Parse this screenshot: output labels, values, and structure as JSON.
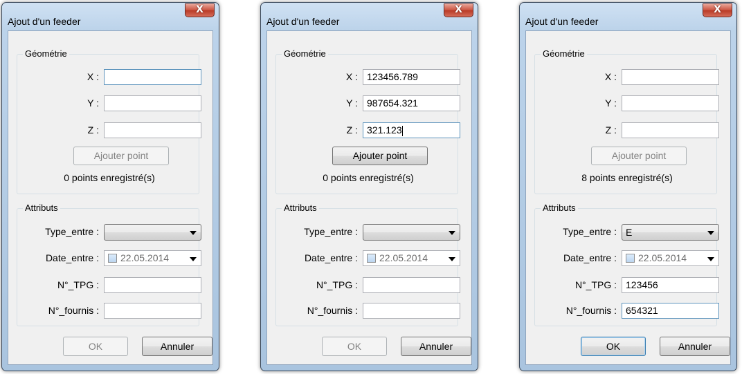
{
  "dialogs": [
    {
      "title": "Ajout d'un feeder",
      "close_label": "X",
      "geometry": {
        "legend": "Géométrie",
        "x_label": "X :",
        "y_label": "Y :",
        "z_label": "Z :",
        "x_value": "",
        "y_value": "",
        "z_value": "",
        "add_point_label": "Ajouter point",
        "add_point_enabled": false,
        "status": "0 points enregistré(s)"
      },
      "attributes": {
        "legend": "Attributs",
        "type_label": "Type_entre :",
        "type_value": "",
        "date_label": "Date_entre :",
        "date_value": "22.05.2014",
        "tpg_label": "N°_TPG :",
        "tpg_value": "",
        "fournis_label": "N°_fournis :",
        "fournis_value": ""
      },
      "ok_label": "OK",
      "ok_enabled": false,
      "cancel_label": "Annuler"
    },
    {
      "title": "Ajout d'un feeder",
      "close_label": "X",
      "geometry": {
        "legend": "Géométrie",
        "x_label": "X :",
        "y_label": "Y :",
        "z_label": "Z :",
        "x_value": "123456.789",
        "y_value": "987654.321",
        "z_value": "321.123",
        "add_point_label": "Ajouter point",
        "add_point_enabled": true,
        "status": "0 points enregistré(s)"
      },
      "attributes": {
        "legend": "Attributs",
        "type_label": "Type_entre :",
        "type_value": "",
        "date_label": "Date_entre :",
        "date_value": "22.05.2014",
        "tpg_label": "N°_TPG :",
        "tpg_value": "",
        "fournis_label": "N°_fournis :",
        "fournis_value": ""
      },
      "ok_label": "OK",
      "ok_enabled": false,
      "cancel_label": "Annuler"
    },
    {
      "title": "Ajout d'un feeder",
      "close_label": "X",
      "geometry": {
        "legend": "Géométrie",
        "x_label": "X :",
        "y_label": "Y :",
        "z_label": "Z :",
        "x_value": "",
        "y_value": "",
        "z_value": "",
        "add_point_label": "Ajouter point",
        "add_point_enabled": false,
        "status": "8 points enregistré(s)"
      },
      "attributes": {
        "legend": "Attributs",
        "type_label": "Type_entre :",
        "type_value": "E",
        "date_label": "Date_entre :",
        "date_value": "22.05.2014",
        "tpg_label": "N°_TPG :",
        "tpg_value": "123456",
        "fournis_label": "N°_fournis :",
        "fournis_value": "654321"
      },
      "ok_label": "OK",
      "ok_enabled": true,
      "cancel_label": "Annuler"
    }
  ]
}
